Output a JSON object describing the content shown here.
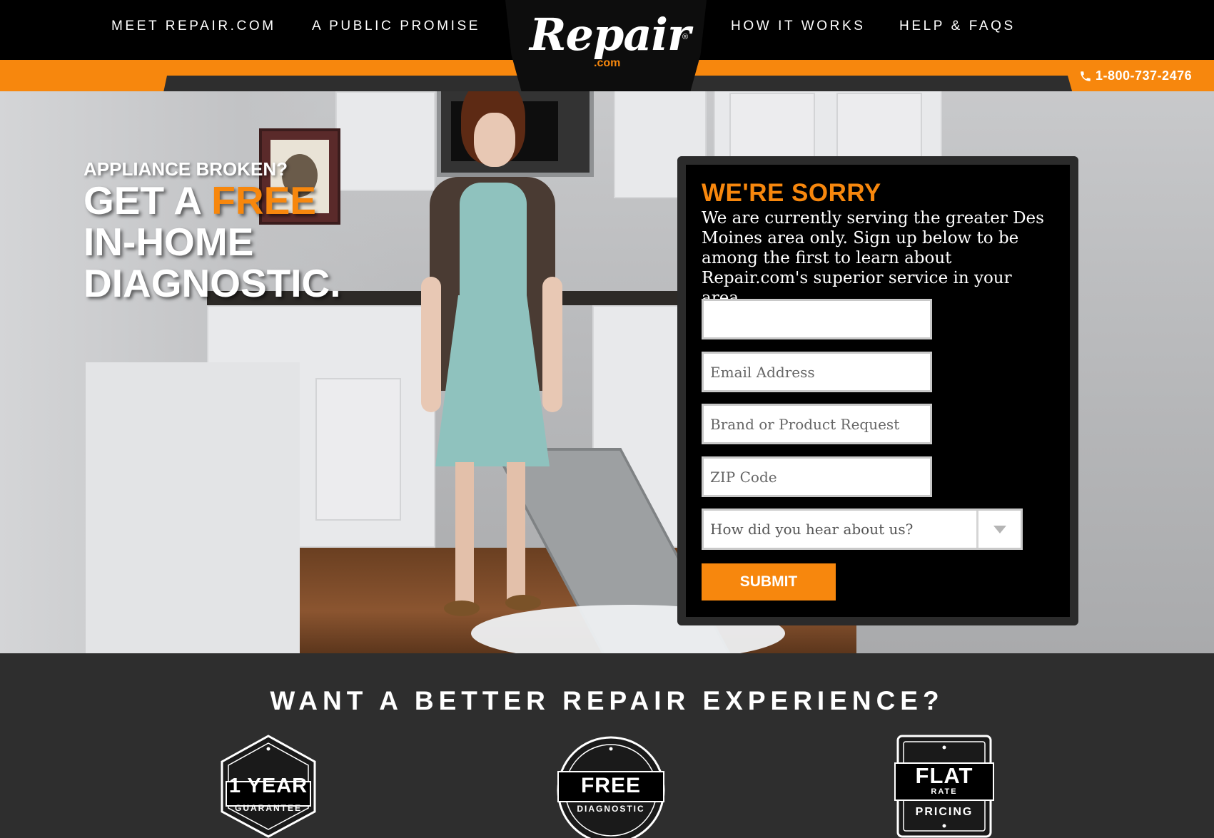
{
  "nav": {
    "left_links": [
      "MEET REPAIR.COM",
      "A PUBLIC PROMISE"
    ],
    "right_links": [
      "HOW IT WORKS",
      "HELP & FAQS"
    ],
    "logo_text": "Repair",
    "logo_reg": "®",
    "logo_sub": ".com",
    "phone": "1-800-737-2476"
  },
  "hero": {
    "headline_small": "APPLIANCE BROKEN?",
    "headline_line1_white": "GET A ",
    "headline_line1_orange": "FREE",
    "headline_line2": "IN-HOME",
    "headline_line3": "DIAGNOSTIC."
  },
  "form": {
    "title": "WE'RE SORRY",
    "message": "We are currently serving the greater Des Moines area only. Sign up below to be among the first to learn about Repair.com's superior service in your area.",
    "fields": [
      {
        "placeholder": "",
        "value": ""
      },
      {
        "placeholder": "Email Address",
        "value": ""
      },
      {
        "placeholder": "Brand or Product Request",
        "value": ""
      },
      {
        "placeholder": "ZIP Code",
        "value": ""
      }
    ],
    "select_label": "How did you hear about us?",
    "submit_label": "SUBMIT"
  },
  "bottom": {
    "title": "WANT A BETTER REPAIR EXPERIENCE?",
    "badges": [
      {
        "main": "1 YEAR",
        "sub": "GUARANTEE"
      },
      {
        "main": "FREE",
        "sub": "DIAGNOSTIC"
      },
      {
        "main": "FLAT",
        "mid": "RATE",
        "sub": "PRICING"
      }
    ]
  },
  "colors": {
    "accent": "#f7870d",
    "nav_bg": "#000000",
    "bottom_bg": "#2e2e2e"
  }
}
